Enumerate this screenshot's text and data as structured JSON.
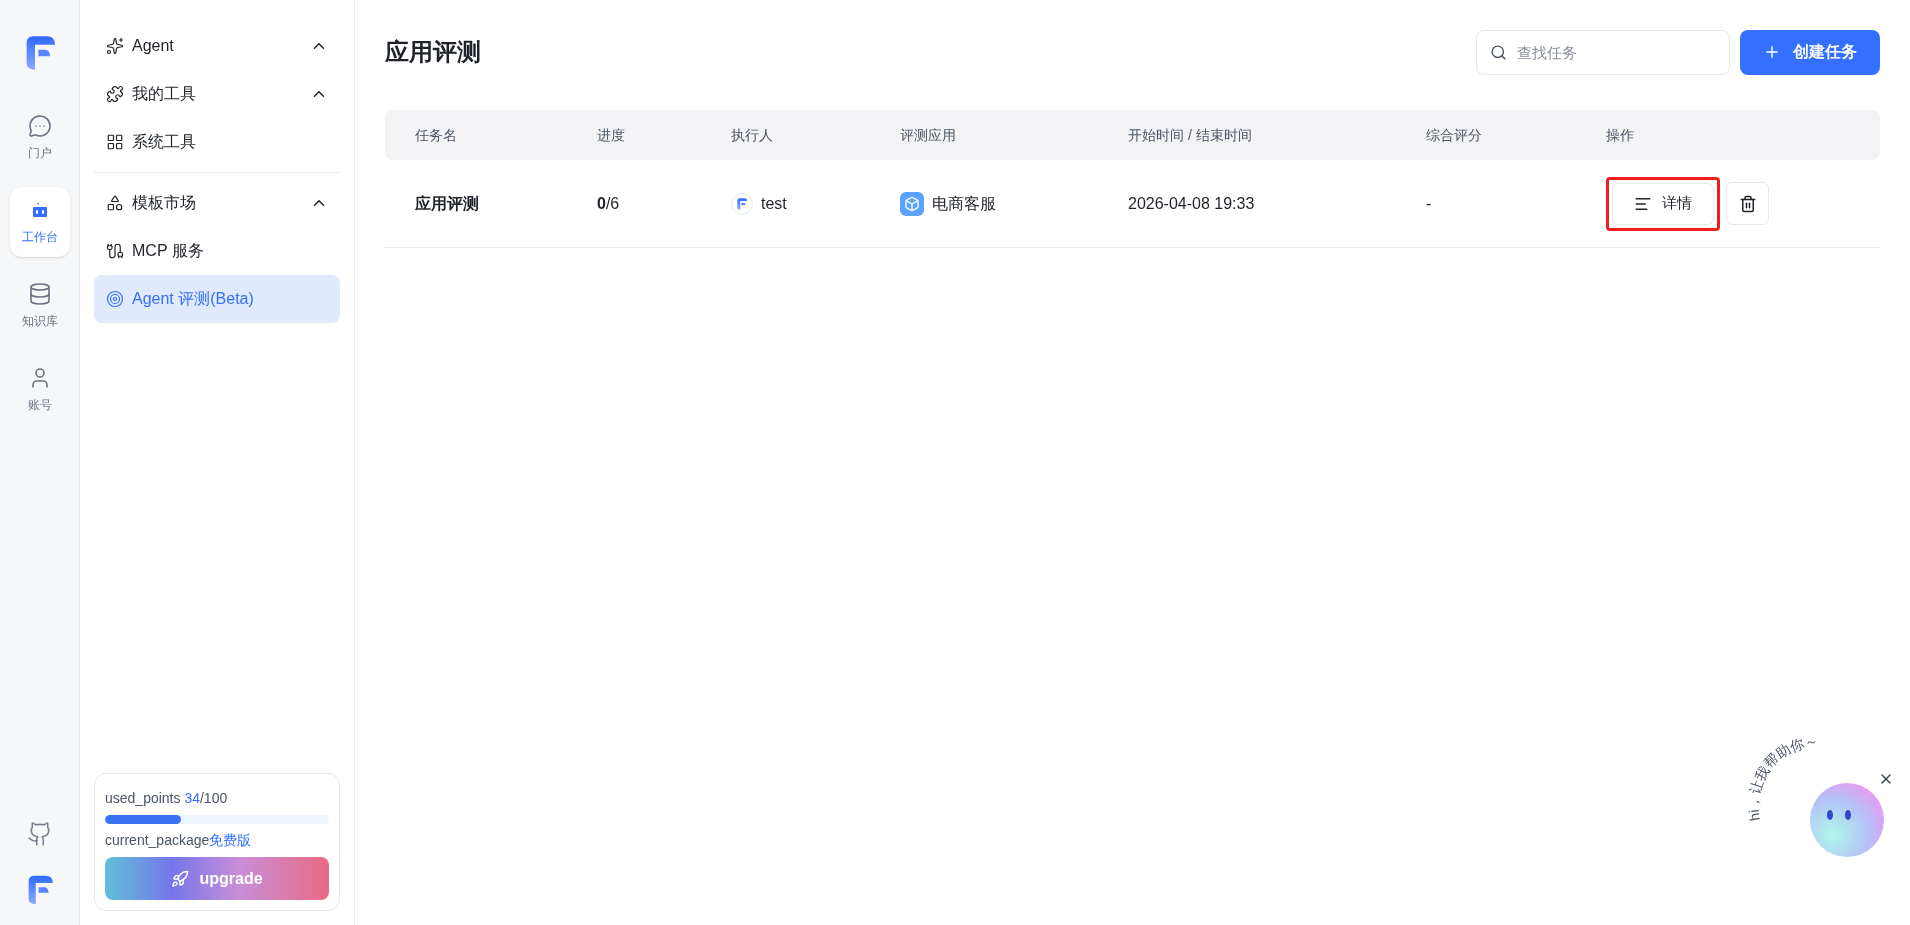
{
  "rail": {
    "items": [
      {
        "kind": "chat",
        "label": "门户",
        "selected": false
      },
      {
        "kind": "bot",
        "label": "工作台",
        "selected": true
      },
      {
        "kind": "database",
        "label": "知识库",
        "selected": false
      },
      {
        "kind": "user",
        "label": "账号",
        "selected": false
      }
    ]
  },
  "sidebar": {
    "sections": [
      {
        "kind": "sparkles",
        "label": "Agent",
        "expanded": true
      },
      {
        "kind": "puzzle",
        "label": "我的工具",
        "expanded": true,
        "children": [
          {
            "kind": "grid",
            "label": "系统工具",
            "selected": false
          }
        ]
      },
      {
        "kind": "shapes",
        "label": "模板市场",
        "expanded": true,
        "children": [
          {
            "kind": "mcp",
            "label": "MCP 服务",
            "selected": false
          },
          {
            "kind": "target",
            "label": "Agent 评测(Beta)",
            "selected": true
          }
        ]
      }
    ],
    "usage": {
      "label": "used_points",
      "used": "34",
      "total": "/100",
      "level": 0.34,
      "package_label": "current_package",
      "package": "免费版",
      "button": "upgrade"
    }
  },
  "page": {
    "title": "应用评测",
    "search": {
      "placeholder": "查找任务"
    },
    "create_button": "创建任务"
  },
  "table": {
    "columns": [
      "任务名",
      "进度",
      "执行人",
      "评测应用",
      "开始时间 / 结束时间",
      "综合评分",
      "操作"
    ],
    "rows": [
      {
        "name": "应用评测",
        "progress": "**0**/6",
        "executor": "test",
        "app": "电商客服",
        "time": "2026-04-08 19:33",
        "score": "-",
        "details_button": "详情",
        "highlighted": true
      }
    ]
  },
  "assistant": {
    "greeting": "hi，让我帮助你～"
  }
}
